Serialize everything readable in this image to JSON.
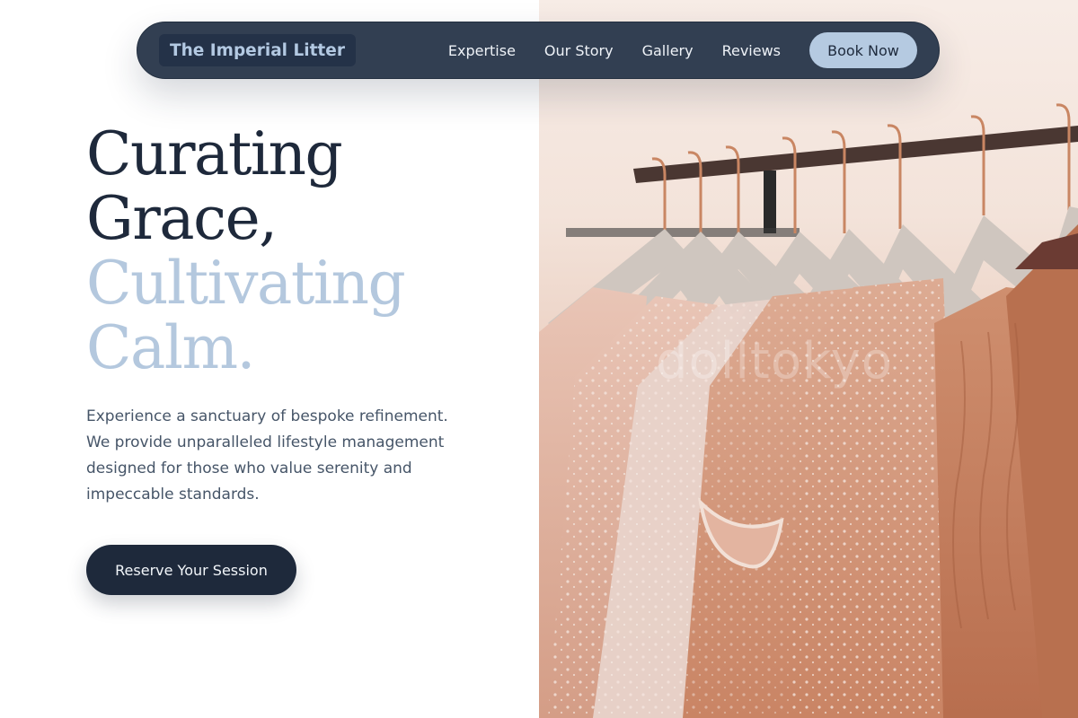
{
  "brand": {
    "name": "The Imperial Litter"
  },
  "nav": {
    "links": [
      "Expertise",
      "Our Story",
      "Gallery",
      "Reviews"
    ],
    "cta_label": "Book Now"
  },
  "hero": {
    "headline_lines": [
      "Curating",
      "Grace,",
      "Cultivating",
      "Calm."
    ],
    "description": "Experience a sanctuary of bespoke refinement. We provide unparalleled lifestyle management designed for those who value serenity and impeccable standards.",
    "cta_label": "Reserve Your Session"
  },
  "image": {
    "subject": "garments-on-rack-photo",
    "watermark_text": "dolltokyo"
  },
  "colors": {
    "navy": "#1e293b",
    "nav_bg": "#323f52",
    "accent_light": "#b4c8de",
    "text_body": "#465568"
  }
}
